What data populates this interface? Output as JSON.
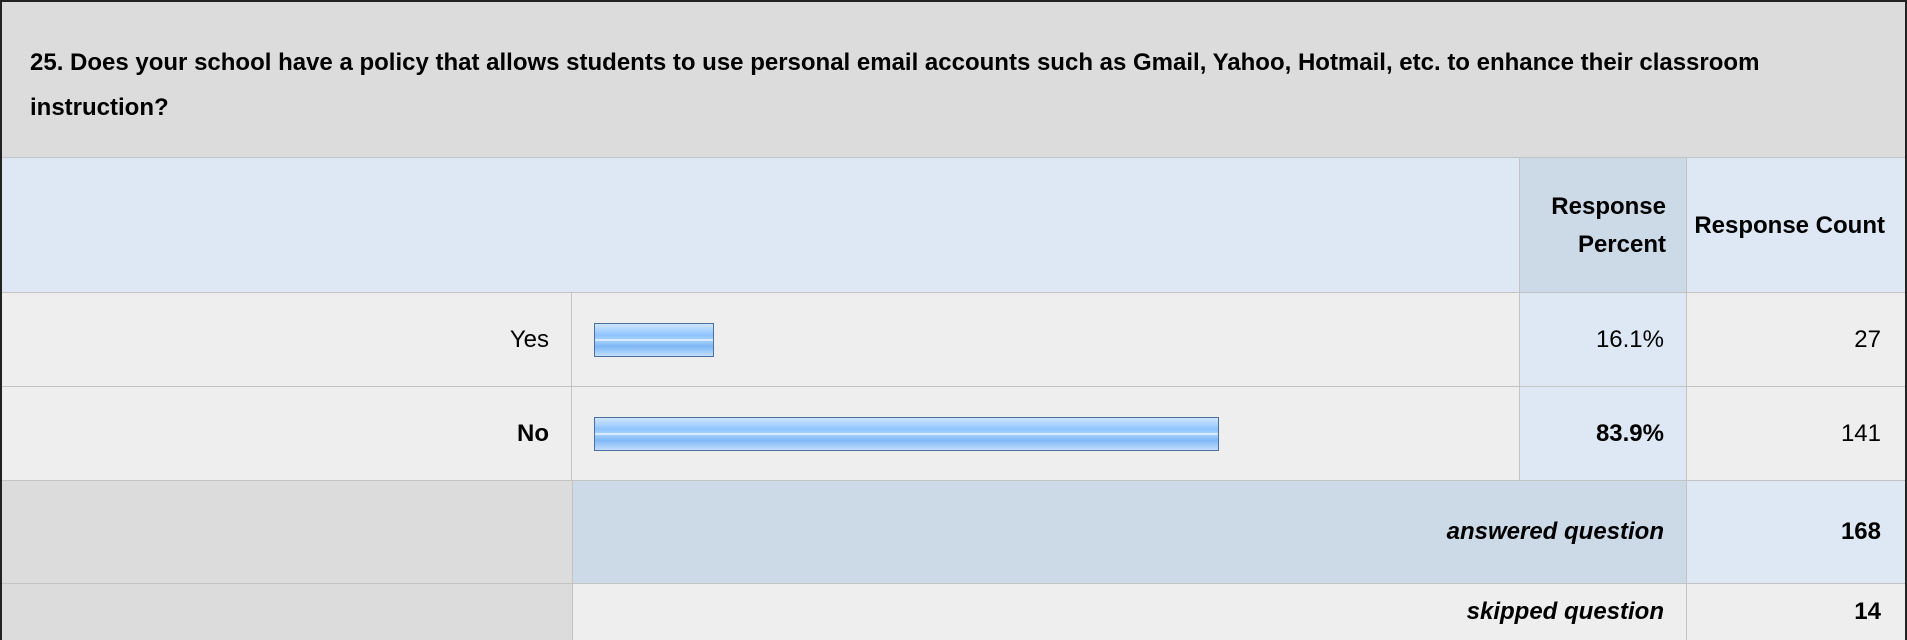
{
  "question": {
    "text": "25. Does your school have a policy that allows students to use personal email accounts such as Gmail, Yahoo, Hotmail, etc. to enhance their classroom instruction?"
  },
  "header": {
    "percent_label": "Response Percent",
    "count_label": "Response Count"
  },
  "chart_data": {
    "type": "bar",
    "orientation": "horizontal",
    "categories": [
      "Yes",
      "No"
    ],
    "values": [
      16.1,
      83.9
    ],
    "counts": [
      27,
      141
    ],
    "value_labels": [
      "16.1%",
      "83.9%"
    ],
    "xlim": [
      0,
      100
    ],
    "bar_color": "#8fc3ff",
    "bar_border_color": "#4d6f9e"
  },
  "rows": [
    {
      "label": "Yes",
      "percent": "16.1%",
      "count": "27"
    },
    {
      "label": "No",
      "percent": "83.9%",
      "count": "141"
    }
  ],
  "summary": {
    "answered_label": "answered question",
    "answered_value": "168",
    "skipped_label": "skipped question",
    "skipped_value": "14"
  }
}
